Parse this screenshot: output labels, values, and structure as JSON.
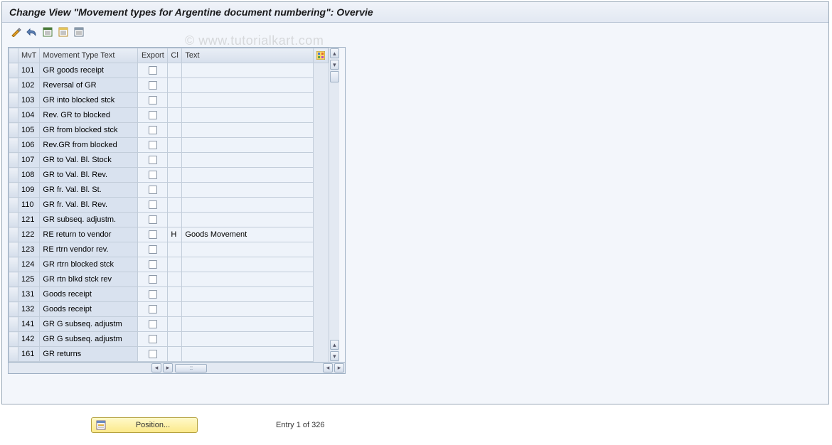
{
  "title": "Change View \"Movement types for Argentine document numbering\": Overvie",
  "watermark": "© www.tutorialkart.com",
  "columns": {
    "mvt": "MvT",
    "desc": "Movement Type Text",
    "export": "Export",
    "cl": "Cl",
    "text": "Text"
  },
  "rows": [
    {
      "mvt": "101",
      "desc": "GR goods receipt",
      "export": false,
      "cl": "",
      "text": ""
    },
    {
      "mvt": "102",
      "desc": "Reversal of GR",
      "export": false,
      "cl": "",
      "text": ""
    },
    {
      "mvt": "103",
      "desc": "GR into blocked stck",
      "export": false,
      "cl": "",
      "text": ""
    },
    {
      "mvt": "104",
      "desc": "Rev. GR to blocked",
      "export": false,
      "cl": "",
      "text": ""
    },
    {
      "mvt": "105",
      "desc": "GR from blocked stck",
      "export": false,
      "cl": "",
      "text": ""
    },
    {
      "mvt": "106",
      "desc": "Rev.GR from blocked",
      "export": false,
      "cl": "",
      "text": ""
    },
    {
      "mvt": "107",
      "desc": "GR to Val. Bl. Stock",
      "export": false,
      "cl": "",
      "text": ""
    },
    {
      "mvt": "108",
      "desc": "GR to Val. Bl. Rev.",
      "export": false,
      "cl": "",
      "text": ""
    },
    {
      "mvt": "109",
      "desc": "GR fr. Val. Bl. St.",
      "export": false,
      "cl": "",
      "text": ""
    },
    {
      "mvt": "110",
      "desc": "GR fr. Val. Bl. Rev.",
      "export": false,
      "cl": "",
      "text": ""
    },
    {
      "mvt": "121",
      "desc": "GR subseq. adjustm.",
      "export": false,
      "cl": "",
      "text": ""
    },
    {
      "mvt": "122",
      "desc": "RE return to vendor",
      "export": false,
      "cl": "H",
      "text": "Goods Movement"
    },
    {
      "mvt": "123",
      "desc": "RE rtrn vendor rev.",
      "export": false,
      "cl": "",
      "text": ""
    },
    {
      "mvt": "124",
      "desc": "GR rtrn blocked stck",
      "export": false,
      "cl": "",
      "text": ""
    },
    {
      "mvt": "125",
      "desc": "GR rtn blkd stck rev",
      "export": false,
      "cl": "",
      "text": ""
    },
    {
      "mvt": "131",
      "desc": "Goods receipt",
      "export": false,
      "cl": "",
      "text": ""
    },
    {
      "mvt": "132",
      "desc": "Goods receipt",
      "export": false,
      "cl": "",
      "text": ""
    },
    {
      "mvt": "141",
      "desc": "GR G subseq. adjustm",
      "export": false,
      "cl": "",
      "text": ""
    },
    {
      "mvt": "142",
      "desc": "GR G subseq. adjustm",
      "export": false,
      "cl": "",
      "text": ""
    },
    {
      "mvt": "161",
      "desc": "GR returns",
      "export": false,
      "cl": "",
      "text": ""
    }
  ],
  "position_button": "Position...",
  "entry_text": "Entry 1 of 326"
}
